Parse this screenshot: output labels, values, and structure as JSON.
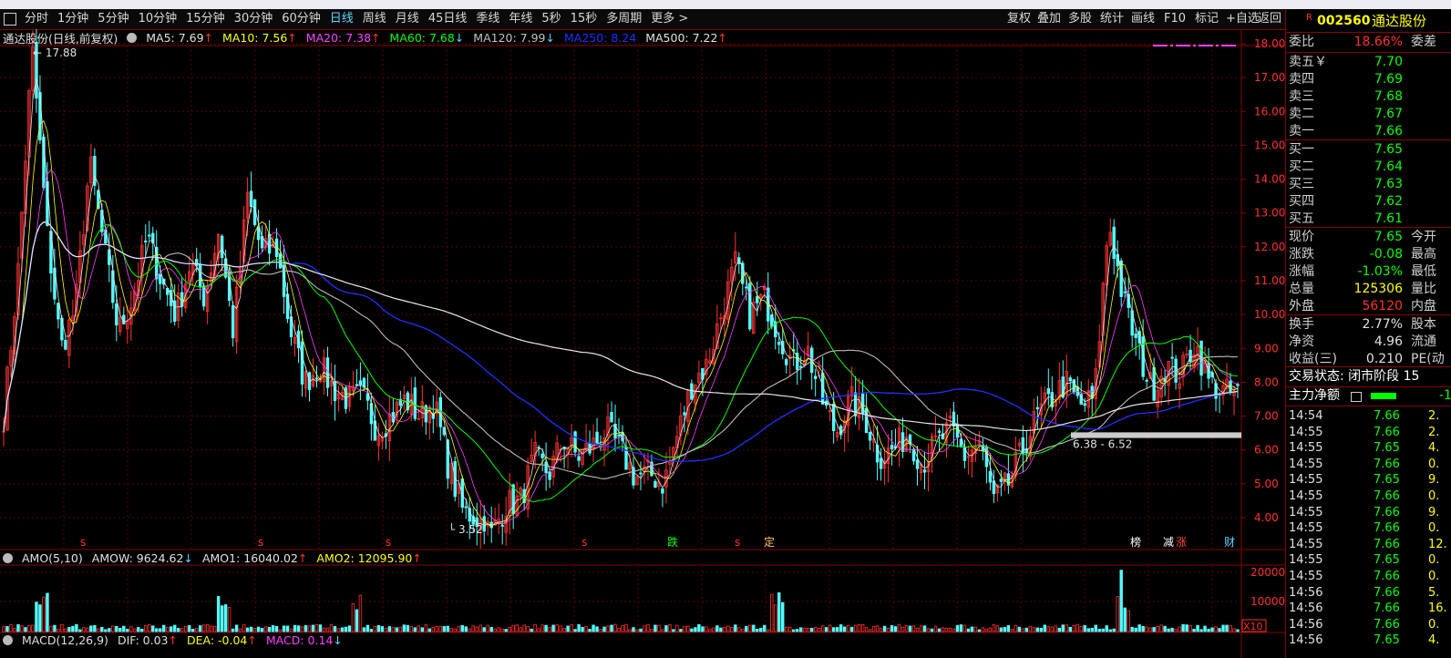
{
  "toolbar": {
    "tabs": [
      "分时",
      "1分钟",
      "5分钟",
      "10分钟",
      "15分钟",
      "30分钟",
      "60分钟",
      "日线",
      "周线",
      "月线",
      "45日线",
      "季线",
      "年线",
      "5秒",
      "15秒",
      "多周期",
      "更多 >"
    ],
    "active_index": 7,
    "right_buttons": [
      "复权",
      "叠加",
      "多股",
      "统计",
      "画线",
      "F10",
      "标记",
      "+自选",
      "返回"
    ]
  },
  "stock_header": {
    "badge": "R",
    "code": "002560",
    "name": "通达股份"
  },
  "price_info": {
    "title": "通达股份(日线,前复权)",
    "ma": [
      {
        "label": "MA5: 7.69",
        "arrow": "↑",
        "color": "#e0e0e0",
        "arrow_color": "#ff3030"
      },
      {
        "label": "MA10: 7.56",
        "arrow": "↑",
        "color": "#ffff00",
        "arrow_color": "#ff3030"
      },
      {
        "label": "MA20: 7.38",
        "arrow": "↑",
        "color": "#ff40ff",
        "arrow_color": "#ff3030"
      },
      {
        "label": "MA60: 7.68",
        "arrow": "↓",
        "color": "#00ff00",
        "arrow_color": "#59d6ff"
      },
      {
        "label": "MA120: 7.99",
        "arrow": "↓",
        "color": "#c0c0c0",
        "arrow_color": "#59d6ff"
      },
      {
        "label": "MA250: 8.24",
        "arrow": "",
        "color": "#2030ff",
        "arrow_color": "#2030ff"
      },
      {
        "label": "MA500: 7.22",
        "arrow": "↑",
        "color": "#e0e0e0",
        "arrow_color": "#ff3030"
      }
    ]
  },
  "price_axis": [
    "18.00",
    "17.00",
    "16.00",
    "15.00",
    "14.00",
    "13.00",
    "12.00",
    "11.00",
    "10.00",
    "9.00",
    "8.00",
    "7.00",
    "6.00",
    "5.00",
    "4.00"
  ],
  "annotations": {
    "high": "17.88",
    "low": "3.52",
    "range": "6.38 - 6.52"
  },
  "event_markers": [
    "s",
    "s",
    "s",
    "s",
    "跌",
    "s",
    "定",
    "榜",
    "减",
    "涨",
    "财"
  ],
  "amo_info": {
    "title": "AMO(5,10)",
    "items": [
      {
        "label": "AMOW: 9624.62",
        "arrow": "↓",
        "color": "#e0e0e0",
        "arrow_color": "#59d6ff"
      },
      {
        "label": "AMO1: 16040.02",
        "arrow": "↑",
        "color": "#e0e0e0",
        "arrow_color": "#ff3030"
      },
      {
        "label": "AMO2: 12095.90",
        "arrow": "↑",
        "color": "#ffff00",
        "arrow_color": "#ff3030"
      }
    ]
  },
  "volume_axis": [
    "20000",
    "10000"
  ],
  "volume_unit": "X10",
  "macd_info": {
    "title": "MACD(12,26,9)",
    "items": [
      {
        "label": "DIF: 0.03",
        "arrow": "↑",
        "color": "#e0e0e0",
        "arrow_color": "#ff3030"
      },
      {
        "label": "DEA: -0.04",
        "arrow": "↑",
        "color": "#ffff00",
        "arrow_color": "#ff3030"
      },
      {
        "label": "MACD: 0.14",
        "arrow": "↓",
        "color": "#ff40ff",
        "arrow_color": "#59d6ff"
      }
    ]
  },
  "quote": {
    "weibi": {
      "label": "委比",
      "value": "18.66%",
      "right": "委差"
    },
    "asks": [
      {
        "label": "卖五￥",
        "price": "7.70"
      },
      {
        "label": "卖四",
        "price": "7.69"
      },
      {
        "label": "卖三",
        "price": "7.68"
      },
      {
        "label": "卖二",
        "price": "7.67"
      },
      {
        "label": "卖一",
        "price": "7.66"
      }
    ],
    "bids": [
      {
        "label": "买一",
        "price": "7.65"
      },
      {
        "label": "买二",
        "price": "7.64"
      },
      {
        "label": "买三",
        "price": "7.63"
      },
      {
        "label": "买四",
        "price": "7.62"
      },
      {
        "label": "买五",
        "price": "7.61"
      }
    ],
    "stats1": [
      {
        "label": "现价",
        "value": "7.65",
        "color": "#00ff00",
        "right": "今开"
      },
      {
        "label": "涨跌",
        "value": "-0.08",
        "color": "#00ff00",
        "right": "最高"
      },
      {
        "label": "涨幅",
        "value": "-1.03%",
        "color": "#00ff00",
        "right": "最低"
      },
      {
        "label": "总量",
        "value": "125306",
        "color": "#ffff00",
        "right": "量比"
      },
      {
        "label": "外盘",
        "value": "56120",
        "color": "#ff3030",
        "right": "内盘"
      }
    ],
    "stats2": [
      {
        "label": "换手",
        "value": "2.77%",
        "color": "#e0e0e0",
        "right": "股本"
      },
      {
        "label": "净资",
        "value": "4.96",
        "color": "#e0e0e0",
        "right": "流通"
      },
      {
        "label": "收益(三)",
        "value": "0.210",
        "color": "#e0e0e0",
        "right": "PE(动"
      }
    ],
    "trade_status": "交易状态: 闭市阶段 15",
    "main_net": {
      "label": "主力净额",
      "value": "-1"
    }
  },
  "ticks": [
    {
      "t": "14:54",
      "p": "7.66",
      "v": "2."
    },
    {
      "t": "14:55",
      "p": "7.66",
      "v": "2."
    },
    {
      "t": "14:55",
      "p": "7.65",
      "v": "4."
    },
    {
      "t": "14:55",
      "p": "7.66",
      "v": "0."
    },
    {
      "t": "14:55",
      "p": "7.65",
      "v": "9."
    },
    {
      "t": "14:55",
      "p": "7.66",
      "v": "0."
    },
    {
      "t": "14:55",
      "p": "7.66",
      "v": "9."
    },
    {
      "t": "14:55",
      "p": "7.66",
      "v": "0."
    },
    {
      "t": "14:55",
      "p": "7.66",
      "v": "12."
    },
    {
      "t": "14:55",
      "p": "7.65",
      "v": "0."
    },
    {
      "t": "14:55",
      "p": "7.66",
      "v": "0."
    },
    {
      "t": "14:56",
      "p": "7.66",
      "v": "5."
    },
    {
      "t": "14:56",
      "p": "7.66",
      "v": "16."
    },
    {
      "t": "14:56",
      "p": "7.66",
      "v": "0."
    },
    {
      "t": "14:56",
      "p": "7.65",
      "v": "4."
    }
  ],
  "chart_data": {
    "type": "candlestick",
    "title": "通达股份(日线,前复权)",
    "ylim": [
      3.5,
      18.3
    ],
    "close_path": [
      7.0,
      11.2,
      17.88,
      12.5,
      9.0,
      10.2,
      14.5,
      12.0,
      9.5,
      10.5,
      12.3,
      11.0,
      10.0,
      11.5,
      10.5,
      12.5,
      9.5,
      13.5,
      11.8,
      12.0,
      9.5,
      8.0,
      8.5,
      7.8,
      7.5,
      7.6,
      6.6,
      7.0,
      7.5,
      7.0,
      7.4,
      5.5,
      4.2,
      4.0,
      3.52,
      4.4,
      4.5,
      5.8,
      5.3,
      6.3,
      5.8,
      6.1,
      6.6,
      6.0,
      5.2,
      5.3,
      5.0,
      6.5,
      8.0,
      8.5,
      10.0,
      11.5,
      10.0,
      10.5,
      9.5,
      8.5,
      9.0,
      7.5,
      6.5,
      7.5,
      7.0,
      5.8,
      6.0,
      6.5,
      5.6,
      6.2,
      6.6,
      5.8,
      6.2,
      4.5,
      5.0,
      6.0,
      7.0,
      7.5,
      8.0,
      7.3,
      7.5,
      12.8,
      10.5,
      9.0,
      7.8,
      8.5,
      8.2,
      9.2,
      8.0,
      7.7,
      7.65
    ],
    "ma_series": [
      "MA5",
      "MA10",
      "MA20",
      "MA60",
      "MA120",
      "MA250",
      "MA500"
    ],
    "volume_range": [
      0,
      21000
    ]
  }
}
